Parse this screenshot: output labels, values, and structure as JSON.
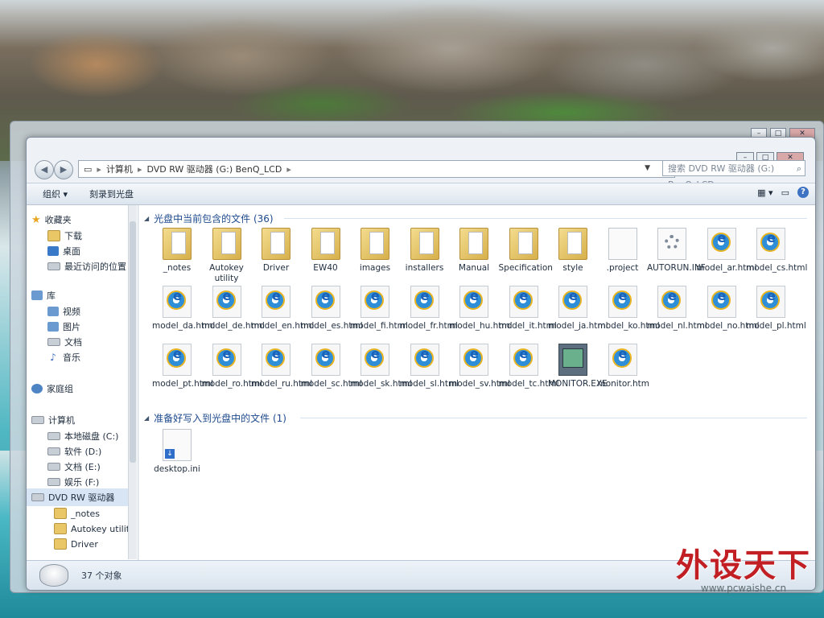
{
  "window": {
    "path_crumbs": [
      "计算机",
      "DVD RW 驱动器 (G:) BenQ_LCD"
    ],
    "search_placeholder": "搜索 DVD RW 驱动器 (G:) BenQ_LCD"
  },
  "toolbar": {
    "organize": "组织 ▾",
    "burn": "刻录到光盘"
  },
  "sidebar": {
    "favorites": "收藏夹",
    "downloads": "下载",
    "desktop": "桌面",
    "recent": "最近访问的位置",
    "libraries": "库",
    "videos": "视频",
    "pictures": "图片",
    "documents": "文档",
    "music": "音乐",
    "homegroup": "家庭组",
    "computer": "计算机",
    "local_c": "本地磁盘 (C:)",
    "soft_d": "软件 (D:)",
    "docs_e": "文档 (E:)",
    "ent_f": "娱乐 (F:)",
    "dvd": "DVD RW 驱动器",
    "notes": "_notes",
    "autokey": "Autokey utility",
    "driver": "Driver"
  },
  "groups": {
    "current": "光盘中当前包含的文件 (36)",
    "ready": "准备好写入到光盘中的文件 (1)"
  },
  "files_current": [
    {
      "name": "_notes",
      "icon": "folder-icon"
    },
    {
      "name": "Autokey utility",
      "icon": "folder-icon"
    },
    {
      "name": "Driver",
      "icon": "folder-icon"
    },
    {
      "name": "EW40",
      "icon": "folder-icon"
    },
    {
      "name": "images",
      "icon": "folder-icon"
    },
    {
      "name": "installers",
      "icon": "folder-icon"
    },
    {
      "name": "Manual",
      "icon": "folder-icon"
    },
    {
      "name": "Specification",
      "icon": "folder-icon"
    },
    {
      "name": "style",
      "icon": "folder-icon"
    },
    {
      "name": ".project",
      "icon": "file-icon"
    },
    {
      "name": "AUTORUN.INF",
      "icon": "settings-file-icon"
    },
    {
      "name": "model_ar.html",
      "icon": "ie-icon"
    },
    {
      "name": "model_cs.html",
      "icon": "ie-icon"
    },
    {
      "name": "model_da.html",
      "icon": "ie-icon"
    },
    {
      "name": "model_de.html",
      "icon": "ie-icon"
    },
    {
      "name": "model_en.html",
      "icon": "ie-icon"
    },
    {
      "name": "model_es.html",
      "icon": "ie-icon"
    },
    {
      "name": "model_fi.html",
      "icon": "ie-icon"
    },
    {
      "name": "model_fr.html",
      "icon": "ie-icon"
    },
    {
      "name": "model_hu.html",
      "icon": "ie-icon"
    },
    {
      "name": "model_it.html",
      "icon": "ie-icon"
    },
    {
      "name": "model_ja.html",
      "icon": "ie-icon"
    },
    {
      "name": "model_ko.html",
      "icon": "ie-icon"
    },
    {
      "name": "model_nl.html",
      "icon": "ie-icon"
    },
    {
      "name": "model_no.html",
      "icon": "ie-icon"
    },
    {
      "name": "model_pl.html",
      "icon": "ie-icon"
    },
    {
      "name": "model_pt.html",
      "icon": "ie-icon"
    },
    {
      "name": "model_ro.html",
      "icon": "ie-icon"
    },
    {
      "name": "model_ru.html",
      "icon": "ie-icon"
    },
    {
      "name": "model_sc.html",
      "icon": "ie-icon"
    },
    {
      "name": "model_sk.html",
      "icon": "ie-icon"
    },
    {
      "name": "model_sl.html",
      "icon": "ie-icon"
    },
    {
      "name": "model_sv.html",
      "icon": "ie-icon"
    },
    {
      "name": "model_tc.html",
      "icon": "ie-icon"
    },
    {
      "name": "MONITOR.EXE",
      "icon": "exe-icon"
    },
    {
      "name": "monitor.htm",
      "icon": "ie-icon"
    }
  ],
  "files_ready": [
    {
      "name": "desktop.ini",
      "icon": "ini-file-icon"
    }
  ],
  "status": {
    "count": "37 个对象"
  },
  "watermark": {
    "brand": "外设天下",
    "url": "www.pcwaishe.cn"
  }
}
